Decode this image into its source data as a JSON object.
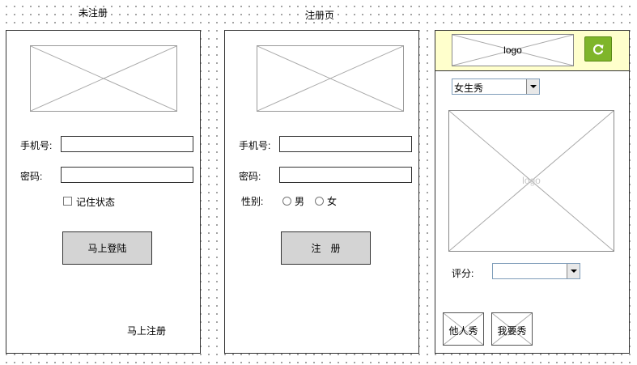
{
  "screens": {
    "login": {
      "title": "未注册",
      "phone_label": "手机号:",
      "password_label": "密码:",
      "remember_label": "记住状态",
      "login_button": "马上登陆",
      "register_link": "马上注册"
    },
    "register": {
      "title": "注册页",
      "phone_label": "手机号:",
      "password_label": "密码:",
      "gender_label": "性别:",
      "gender_male": "男",
      "gender_female": "女",
      "register_button": "注　册"
    },
    "show": {
      "header_logo": "logo",
      "category_select": "女生秀",
      "main_image_label": "logo",
      "rating_label": "评分:",
      "rating_value": "",
      "others_show_button": "他人秀",
      "my_show_button": "我要秀"
    }
  },
  "colors": {
    "header_background": "#ffffcc",
    "refresh_button": "#7fb52a"
  },
  "icons": {
    "refresh": "refresh-icon"
  }
}
